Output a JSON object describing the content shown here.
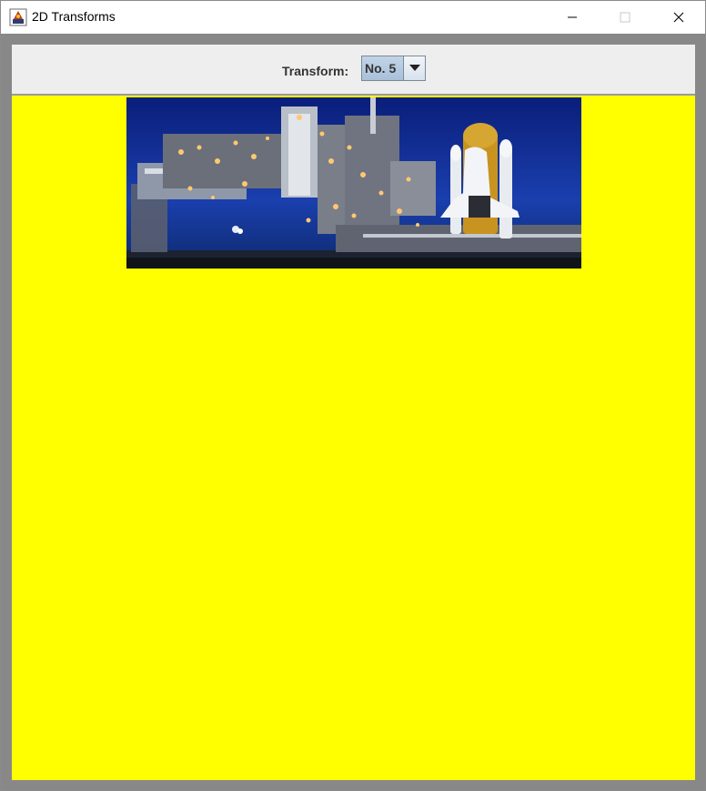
{
  "window": {
    "title": "2D Transforms",
    "icons": {
      "app": "java-app-icon",
      "minimize": "minimize-icon",
      "maximize": "maximize-icon",
      "close": "close-icon"
    }
  },
  "toolbar": {
    "transform_label": "Transform:",
    "transform_select": {
      "selected": "No. 5",
      "icon": "chevron-down-icon"
    }
  },
  "canvas": {
    "background_color": "#ffff00",
    "image": "space-shuttle-launch-pad-photo"
  }
}
